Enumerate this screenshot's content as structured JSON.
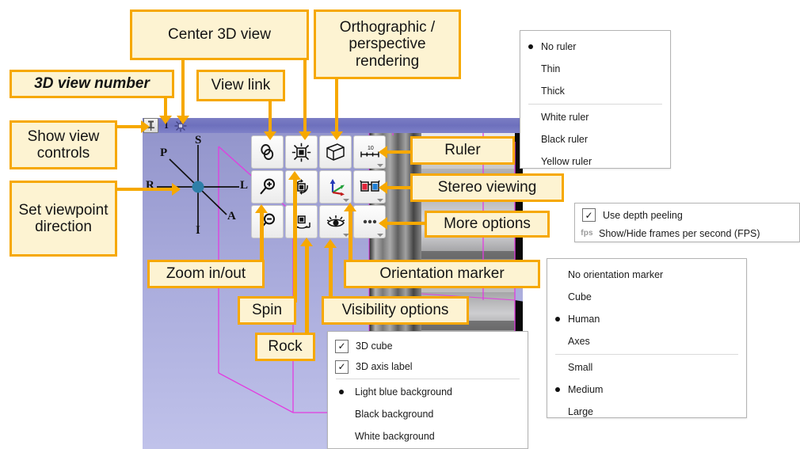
{
  "view": {
    "number": "1",
    "pin_icon": "pin-icon",
    "center_icon": "center-3d-view-icon",
    "corner_label": "A",
    "axis_labels": {
      "superior": "S",
      "inferior": "I",
      "left": "L",
      "right": "R",
      "anterior": "A",
      "posterior": "P"
    }
  },
  "toolbar": {
    "buttons": [
      {
        "name": "view-link-button",
        "icon": "link-chain-icon",
        "label": "View link",
        "dropdown": false
      },
      {
        "name": "center-3d-view-button",
        "icon": "center-crosshair-icon",
        "label": "Center 3D view",
        "dropdown": false
      },
      {
        "name": "ortho-perspective-button",
        "icon": "cube-perspective-icon",
        "label": "Orthographic / perspective rendering",
        "dropdown": false
      },
      {
        "name": "ruler-button",
        "icon": "ruler-icon",
        "label": "Ruler",
        "dropdown": true
      },
      {
        "name": "zoom-in-button",
        "icon": "magnifier-plus-icon",
        "label": "Zoom in",
        "dropdown": false
      },
      {
        "name": "spin-button",
        "icon": "spin-icon",
        "label": "Spin",
        "dropdown": false
      },
      {
        "name": "orientation-marker-button",
        "icon": "axes-arrows-icon",
        "label": "Orientation marker",
        "dropdown": true
      },
      {
        "name": "stereo-viewing-button",
        "icon": "3d-glasses-icon",
        "label": "Stereo viewing",
        "dropdown": true
      },
      {
        "name": "zoom-out-button",
        "icon": "magnifier-minus-icon",
        "label": "Zoom out",
        "dropdown": false
      },
      {
        "name": "rock-button",
        "icon": "rock-icon",
        "label": "Rock",
        "dropdown": false
      },
      {
        "name": "visibility-options-button",
        "icon": "eye-icon",
        "label": "Visibility options",
        "dropdown": true
      },
      {
        "name": "more-options-button",
        "icon": "ellipsis-icon",
        "label": "More options",
        "dropdown": true
      }
    ]
  },
  "menus": {
    "ruler": {
      "items": [
        {
          "label": "No ruler",
          "selected": true
        },
        {
          "label": "Thin",
          "selected": false
        },
        {
          "label": "Thick",
          "selected": false
        },
        {
          "label": "White ruler",
          "selected": false
        },
        {
          "label": "Black ruler",
          "selected": false
        },
        {
          "label": "Yellow ruler",
          "selected": false
        }
      ],
      "separator_after": 2
    },
    "more_options": {
      "items": [
        {
          "label": "Use depth peeling",
          "checked": true,
          "type": "checkbox"
        },
        {
          "label": "Show/Hide frames per second (FPS)",
          "type": "fps",
          "icon_text": "fps"
        }
      ]
    },
    "orientation_marker": {
      "items": [
        {
          "label": "No orientation marker",
          "selected": false
        },
        {
          "label": "Cube",
          "selected": false
        },
        {
          "label": "Human",
          "selected": true
        },
        {
          "label": "Axes",
          "selected": false
        },
        {
          "label": "Small",
          "selected": false
        },
        {
          "label": "Medium",
          "selected": true
        },
        {
          "label": "Large",
          "selected": false
        }
      ],
      "separator_after": 3
    },
    "visibility": {
      "items": [
        {
          "label": "3D cube",
          "checked": true,
          "type": "checkbox"
        },
        {
          "label": "3D axis label",
          "checked": true,
          "type": "checkbox"
        },
        {
          "label": "Light blue background",
          "selected": true,
          "type": "radio"
        },
        {
          "label": "Black background",
          "selected": false,
          "type": "radio"
        },
        {
          "label": "White background",
          "selected": false,
          "type": "radio"
        }
      ],
      "separator_after": 1
    }
  },
  "callouts": {
    "view_number": "3D view number",
    "center_3d_view": "Center 3D view",
    "view_link": "View link",
    "ortho_perspective": "Orthographic / perspective rendering",
    "show_view_controls": "Show view controls",
    "set_viewpoint": "Set viewpoint direction",
    "ruler": "Ruler",
    "stereo_viewing": "Stereo viewing",
    "more_options": "More options",
    "zoom_in_out": "Zoom in/out",
    "spin": "Spin",
    "rock": "Rock",
    "visibility_options": "Visibility options",
    "orientation_marker": "Orientation marker"
  },
  "colors": {
    "callout_fill": "#fdf3d2",
    "callout_border": "#f6a800",
    "header_bar": "#7476c1",
    "bg_top": "#9193ca",
    "bg_bottom": "#c0c2ea",
    "wireframe": "#e23ce0"
  }
}
